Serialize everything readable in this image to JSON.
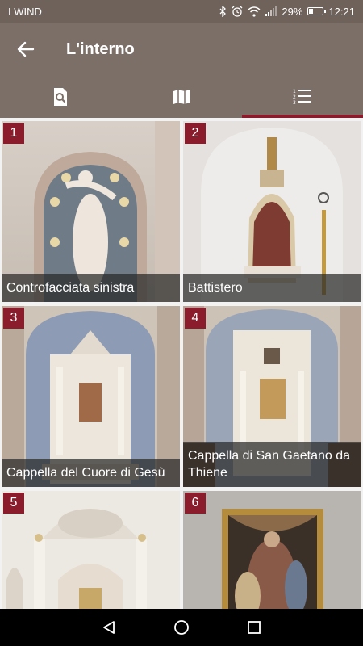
{
  "status_bar": {
    "carrier": "I WIND",
    "battery_text": "29%",
    "battery_level": 0.29,
    "time": "12:21"
  },
  "app_bar": {
    "title": "L'interno",
    "back_icon": "arrow-left-icon"
  },
  "tabs": [
    {
      "icon": "search-document-icon",
      "active": false
    },
    {
      "icon": "map-icon",
      "active": false
    },
    {
      "icon": "numbered-list-icon",
      "active": true
    }
  ],
  "items": [
    {
      "number": "1",
      "caption": "Controfacciata sinistra"
    },
    {
      "number": "2",
      "caption": "Battistero"
    },
    {
      "number": "3",
      "caption": "Cappella del Cuore di Gesù"
    },
    {
      "number": "4",
      "caption": "Cappella di San Gaetano da Thiene"
    },
    {
      "number": "5",
      "caption": ""
    },
    {
      "number": "6",
      "caption": ""
    }
  ],
  "nav_bar": [
    "back-triangle-icon",
    "home-circle-icon",
    "recents-square-icon"
  ],
  "colors": {
    "status_bar": "#6e625b",
    "app_bar": "#7b6f68",
    "accent": "#8b1c2b"
  }
}
